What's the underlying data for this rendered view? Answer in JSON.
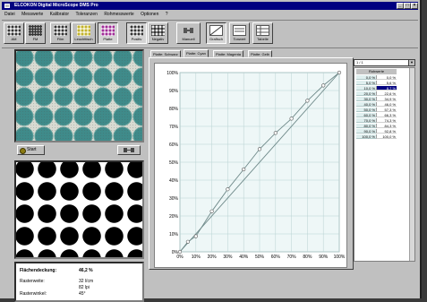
{
  "window": {
    "title": "ELCOKON Digital MicroScope DMS Pro",
    "controls": {
      "minimize": "_",
      "maximize": "□",
      "close": "×"
    }
  },
  "menu": {
    "items": [
      "Datei",
      "Messwerte",
      "Kalibrator",
      "Toleranzen",
      "Rohmesswerte",
      "Optionen",
      "?"
    ]
  },
  "toolbar": {
    "buttons": [
      {
        "id": "am",
        "label": "AM",
        "icon": "halftone-am-icon"
      },
      {
        "id": "fm",
        "label": "FM",
        "icon": "halftone-fm-icon"
      },
      {
        "id": "film",
        "label": "Film",
        "icon": "film-icon"
      },
      {
        "id": "leuchttisch",
        "label": "Leuchttisch",
        "icon": "lighttable-icon"
      },
      {
        "id": "platte",
        "label": "Platte",
        "icon": "plate-icon"
      },
      {
        "id": "positiv",
        "label": "Positiv",
        "icon": "positive-icon"
      },
      {
        "id": "negativ",
        "label": "Negativ",
        "icon": "negative-icon"
      },
      {
        "id": "manuell",
        "label": "Manuell",
        "icon": "microscope-icon"
      },
      {
        "id": "grafisch",
        "label": "Grafisch",
        "icon": "graph-icon"
      },
      {
        "id": "tonwert",
        "label": "Tonwert",
        "icon": "tonwert-icon"
      },
      {
        "id": "tabelle",
        "label": "Tabelle",
        "icon": "table-icon"
      }
    ]
  },
  "left": {
    "start_label": "Start",
    "scope_icon": "microscope-icon",
    "info": {
      "flaechendeckung_label": "Flächendeckung:",
      "flaechendeckung_value": "46,2 %",
      "rasterweite_label": "Rasterweite:",
      "rasterweite_value1": "32 l/cm",
      "rasterweite_value2": "82 lpi",
      "rasterwinkel_label": "Rasterwinkel:",
      "rasterwinkel_value": "45°"
    }
  },
  "tabs": [
    {
      "label": "Platte: Schwarz",
      "active": false
    },
    {
      "label": "Platte: Cyan",
      "active": true
    },
    {
      "label": "Platte: Magenta",
      "active": false
    },
    {
      "label": "Platte: Gelb",
      "active": false
    }
  ],
  "side": {
    "combo_value": "1 / 1",
    "combo_arrow": "▼",
    "table_header": "Rohwerte",
    "rows": [
      {
        "in": "0,0 %",
        "out": "0,0 %"
      },
      {
        "in": "5,0 %",
        "out": "5,6 %"
      },
      {
        "in": "10,0 %",
        "out": "8,7 %",
        "selected": true
      },
      {
        "in": "20,0 %",
        "out": "22,6 %"
      },
      {
        "in": "30,0 %",
        "out": "34,9 %"
      },
      {
        "in": "40,0 %",
        "out": "46,0 %"
      },
      {
        "in": "50,0 %",
        "out": "57,3 %"
      },
      {
        "in": "60,0 %",
        "out": "66,3 %"
      },
      {
        "in": "70,0 %",
        "out": "74,3 %"
      },
      {
        "in": "80,0 %",
        "out": "84,3 %"
      },
      {
        "in": "90,0 %",
        "out": "92,8 %"
      },
      {
        "in": "100,0 %",
        "out": "100,0 %"
      }
    ]
  },
  "chart_data": {
    "type": "line",
    "title": "",
    "xlabel": "",
    "ylabel": "",
    "xlim": [
      0,
      100
    ],
    "ylim": [
      0,
      100
    ],
    "grid": true,
    "x_ticks": [
      "0%",
      "10%",
      "20%",
      "30%",
      "40%",
      "50%",
      "60%",
      "70%",
      "80%",
      "90%",
      "100%"
    ],
    "y_ticks": [
      "0%",
      "10%",
      "20%",
      "30%",
      "40%",
      "50%",
      "60%",
      "70%",
      "80%",
      "90%",
      "100%"
    ],
    "series": [
      {
        "x": [
          0,
          100
        ],
        "y": [
          0,
          100
        ],
        "color": "#6f8a8a"
      },
      {
        "x": [
          0,
          5,
          10,
          20,
          30,
          40,
          50,
          60,
          70,
          80,
          90,
          100
        ],
        "y": [
          0,
          5.6,
          8.7,
          22.6,
          34.9,
          46.0,
          57.3,
          66.3,
          74.3,
          84.3,
          92.8,
          100.0
        ],
        "color": "#6f8a8a",
        "markers": true
      }
    ]
  }
}
